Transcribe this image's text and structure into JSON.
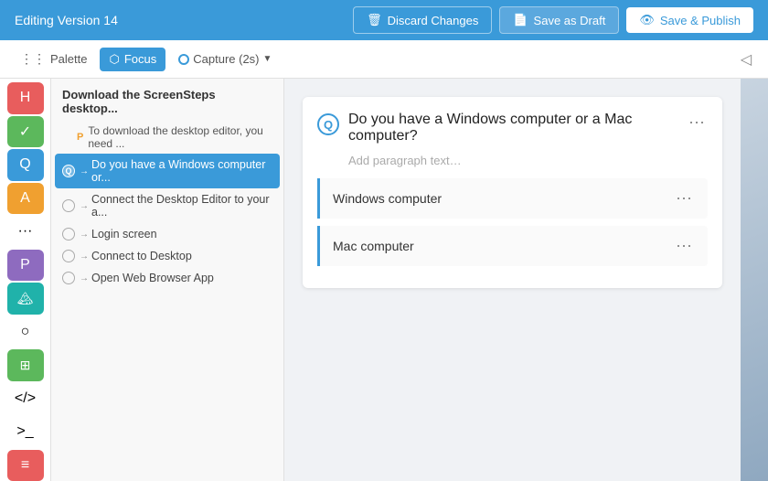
{
  "topbar": {
    "editing_title": "Editing Version 14",
    "discard_label": "Discard Changes",
    "draft_label": "Save as Draft",
    "publish_label": "Save & Publish"
  },
  "toolbar": {
    "palette_label": "Palette",
    "focus_label": "Focus",
    "capture_label": "Capture (2s)"
  },
  "sidebar": {
    "section_title": "Download the ScreenSteps desktop...",
    "sub_item": "To download the desktop editor, you need ...",
    "items": [
      {
        "id": "item1",
        "label": "Do you have a Windows computer or...",
        "active": true
      },
      {
        "id": "item2",
        "label": "Connect the Desktop Editor to your a..."
      },
      {
        "id": "item3",
        "label": "Login screen"
      },
      {
        "id": "item4",
        "label": "Connect to Desktop"
      },
      {
        "id": "item5",
        "label": "Open Web Browser App"
      }
    ]
  },
  "question": {
    "title": "Do you have a Windows computer or a Mac computer?",
    "placeholder": "Add paragraph text…",
    "answers": [
      {
        "id": "ans1",
        "text": "Windows computer"
      },
      {
        "id": "ans2",
        "text": "Mac computer"
      }
    ]
  },
  "icons": {
    "heading": "H",
    "check": "✓",
    "question": "Q",
    "text_a": "A",
    "dots": "···",
    "p_icon": "P",
    "landscape": "🏔",
    "circle": "○",
    "table": "▦",
    "code": "</>",
    "terminal": ">_",
    "list": "≡"
  }
}
